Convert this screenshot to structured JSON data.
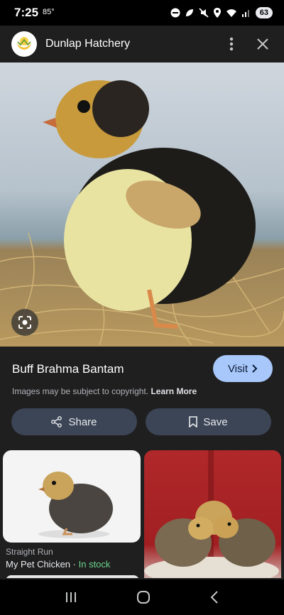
{
  "status_bar": {
    "time": "7:25",
    "temperature": "85°",
    "battery": "63"
  },
  "header": {
    "title": "Dunlap Hatchery",
    "logo_icon": "hatchery-chick-logo"
  },
  "image": {
    "subject_icon": "chick-photo"
  },
  "info": {
    "title": "Buff Brahma Bantam",
    "visit_label": "Visit",
    "copyright_text": "Images may be subject to copyright.",
    "learn_more_label": "Learn More",
    "share_label": "Share",
    "save_label": "Save"
  },
  "related": [
    {
      "label": "Straight Run",
      "source": "My Pet Chicken",
      "separator": " · ",
      "stock": "In stock"
    },
    {
      "label": "",
      "source": ""
    }
  ],
  "colors": {
    "accent": "#a8c7fa",
    "in_stock": "#6dd58c",
    "surface": "#1f1f1f",
    "chip": "#3c4556"
  }
}
